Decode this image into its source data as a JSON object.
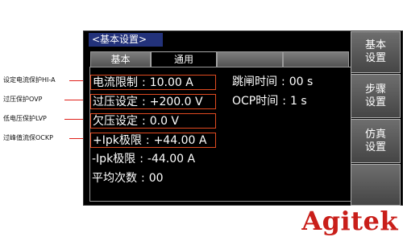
{
  "annotations": {
    "hi_a": "设定电流保护HI-A",
    "ovp": "过压保护OVP",
    "lvp": "低电压保护LVP",
    "ockp": "过峰值流保OCKP"
  },
  "screen": {
    "title": "<基本设置>",
    "tabs": [
      "基本",
      "通用",
      "",
      ""
    ],
    "params": {
      "current_limit": {
        "label": "电流限制",
        "value": "10.00 A"
      },
      "ovp": {
        "label": "过压设定",
        "value": "+200.0 V"
      },
      "uvp": {
        "label": "欠压设定",
        "value": "0.0 V"
      },
      "ipk_pos": {
        "label": "+Ipk极限",
        "value": "+44.00 A"
      },
      "ipk_neg": {
        "label": "-Ipk极限",
        "value": "-44.00 A"
      },
      "avg": {
        "label": "平均次数",
        "value": "00"
      },
      "trip_time": {
        "label": "跳闸时间",
        "value": "00 s"
      },
      "ocp_time": {
        "label": "OCP时间",
        "value": "1 s"
      }
    },
    "separator": ":",
    "side_buttons": {
      "basic": [
        "基本",
        "设置"
      ],
      "step": [
        "步骤",
        "设置"
      ],
      "sim": [
        "仿真",
        "设置"
      ]
    }
  },
  "logo": "Agitek",
  "colors": {
    "highlight": "#e04a20",
    "arrow": "#e0201a",
    "title_bar": "#23327a",
    "logo": "#c91f1a"
  }
}
